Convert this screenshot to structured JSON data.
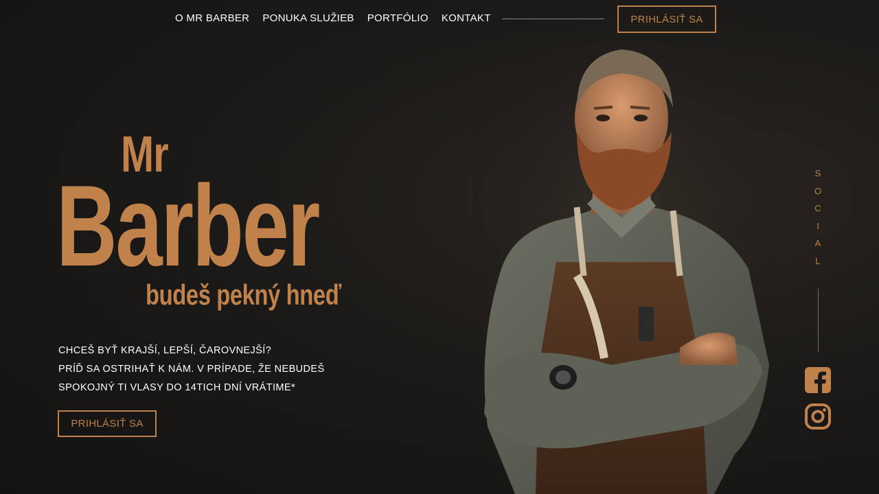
{
  "nav": {
    "links": [
      "O MR BARBER",
      "PONUKA SLUŽIEB",
      "PORTFÓLIO",
      "KONTAKT"
    ],
    "login_label": "PRIHLÁSIŤ SA"
  },
  "hero": {
    "title_line1": "Mr",
    "title_line2": "Barber",
    "subtitle": "budeš pekný hneď",
    "tagline": [
      "CHCEŠ BYŤ KRAJŠÍ, LEPŠÍ, ČAROVNEJŠÍ?",
      "PRÍĎ SA OSTRIHAŤ K NÁM. V PRÍPADE, ŽE NEBUDEŠ",
      "SPOKOJNÝ TI VLASY DO 14TICH DNÍ VRÁTIME*"
    ],
    "cta_label": "PRIHLÁSIŤ SA"
  },
  "social": {
    "label": "SOCIAL",
    "icons": [
      "facebook-icon",
      "instagram-icon"
    ]
  },
  "colors": {
    "accent": "#c0824a",
    "background": "#1c1a18",
    "text": "#ffffff"
  }
}
